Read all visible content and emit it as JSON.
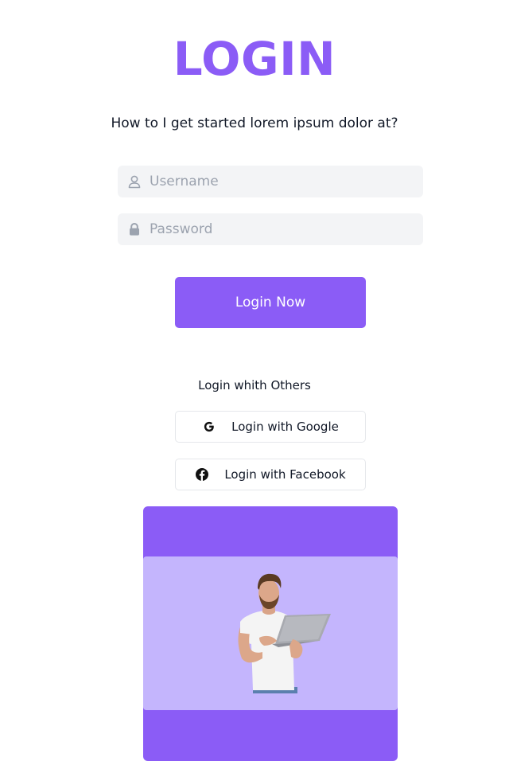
{
  "page": {
    "title": "LOGIN",
    "subtitle": "How to I get started lorem ipsum dolor at?"
  },
  "form": {
    "username": {
      "placeholder": "Username",
      "value": ""
    },
    "password": {
      "placeholder": "Password",
      "value": ""
    },
    "submit_label": "Login Now"
  },
  "social": {
    "heading": "Login whith Others",
    "google_label": "Login with Google",
    "facebook_label": "Login with Facebook"
  },
  "icons": {
    "username": "user-icon",
    "password": "lock-icon",
    "google": "google-icon",
    "facebook": "facebook-icon"
  },
  "colors": {
    "accent": "#8b5cf6",
    "accent_light": "#c4b5fd",
    "field_bg": "#f3f4f6",
    "placeholder": "#9ca3af"
  }
}
